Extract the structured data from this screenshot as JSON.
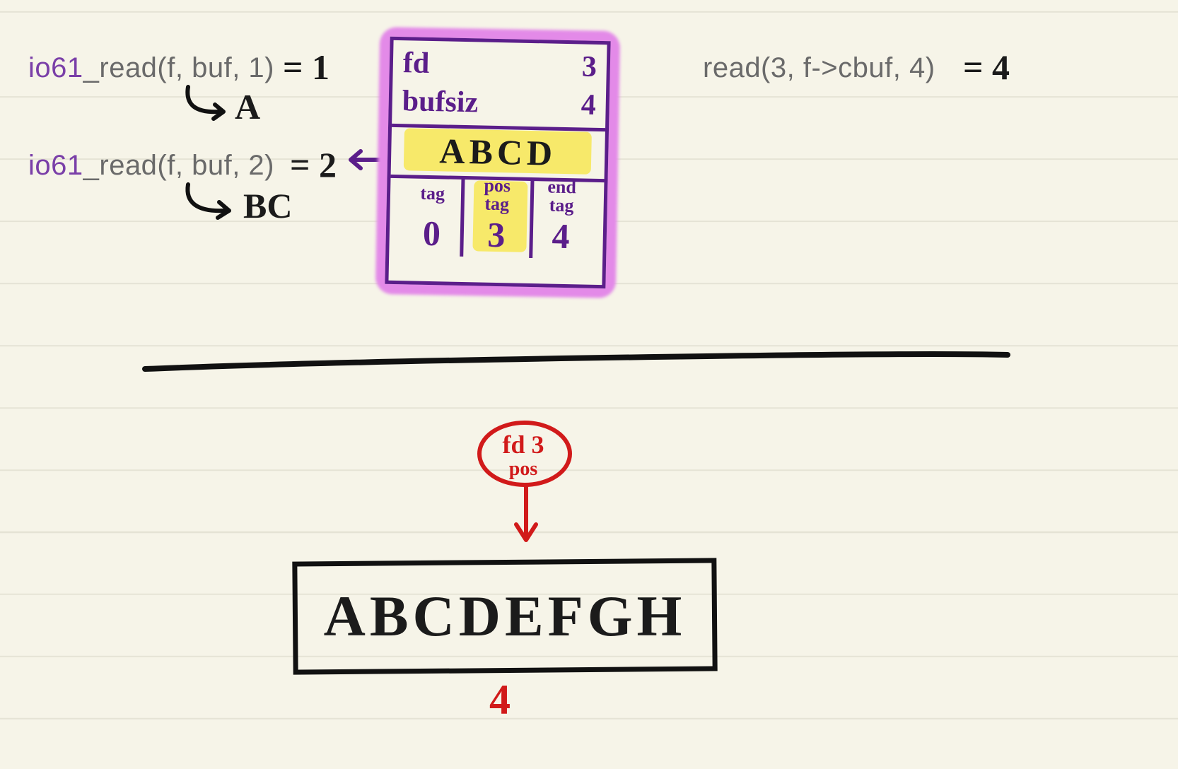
{
  "calls": {
    "call1": {
      "prefix": "io61",
      "rest": "_read(f, buf, 1)",
      "result": "= 1",
      "copied": "A"
    },
    "call2": {
      "prefix": "io61",
      "rest": "_read(f, buf, 2)",
      "result": "= 2",
      "copied": "BC"
    },
    "syscall": {
      "text": "read(3, f->cbuf, 4)",
      "result": "= 4"
    }
  },
  "struct": {
    "fields": {
      "fd": "fd",
      "fd_val": "3",
      "bufsiz": "bufsiz",
      "bufsiz_val": "4"
    },
    "cbuf": "ABCD",
    "labels": {
      "tag": "tag",
      "pos_tag": "pos\ntag",
      "end_tag": "end\ntag"
    },
    "values": {
      "tag": "0",
      "pos_tag": "3",
      "end_tag": "4"
    }
  },
  "kernel": {
    "bubble_line1": "fd 3",
    "bubble_line2": "pos",
    "file_content": "ABCDEFGH",
    "file_pos": "4"
  }
}
